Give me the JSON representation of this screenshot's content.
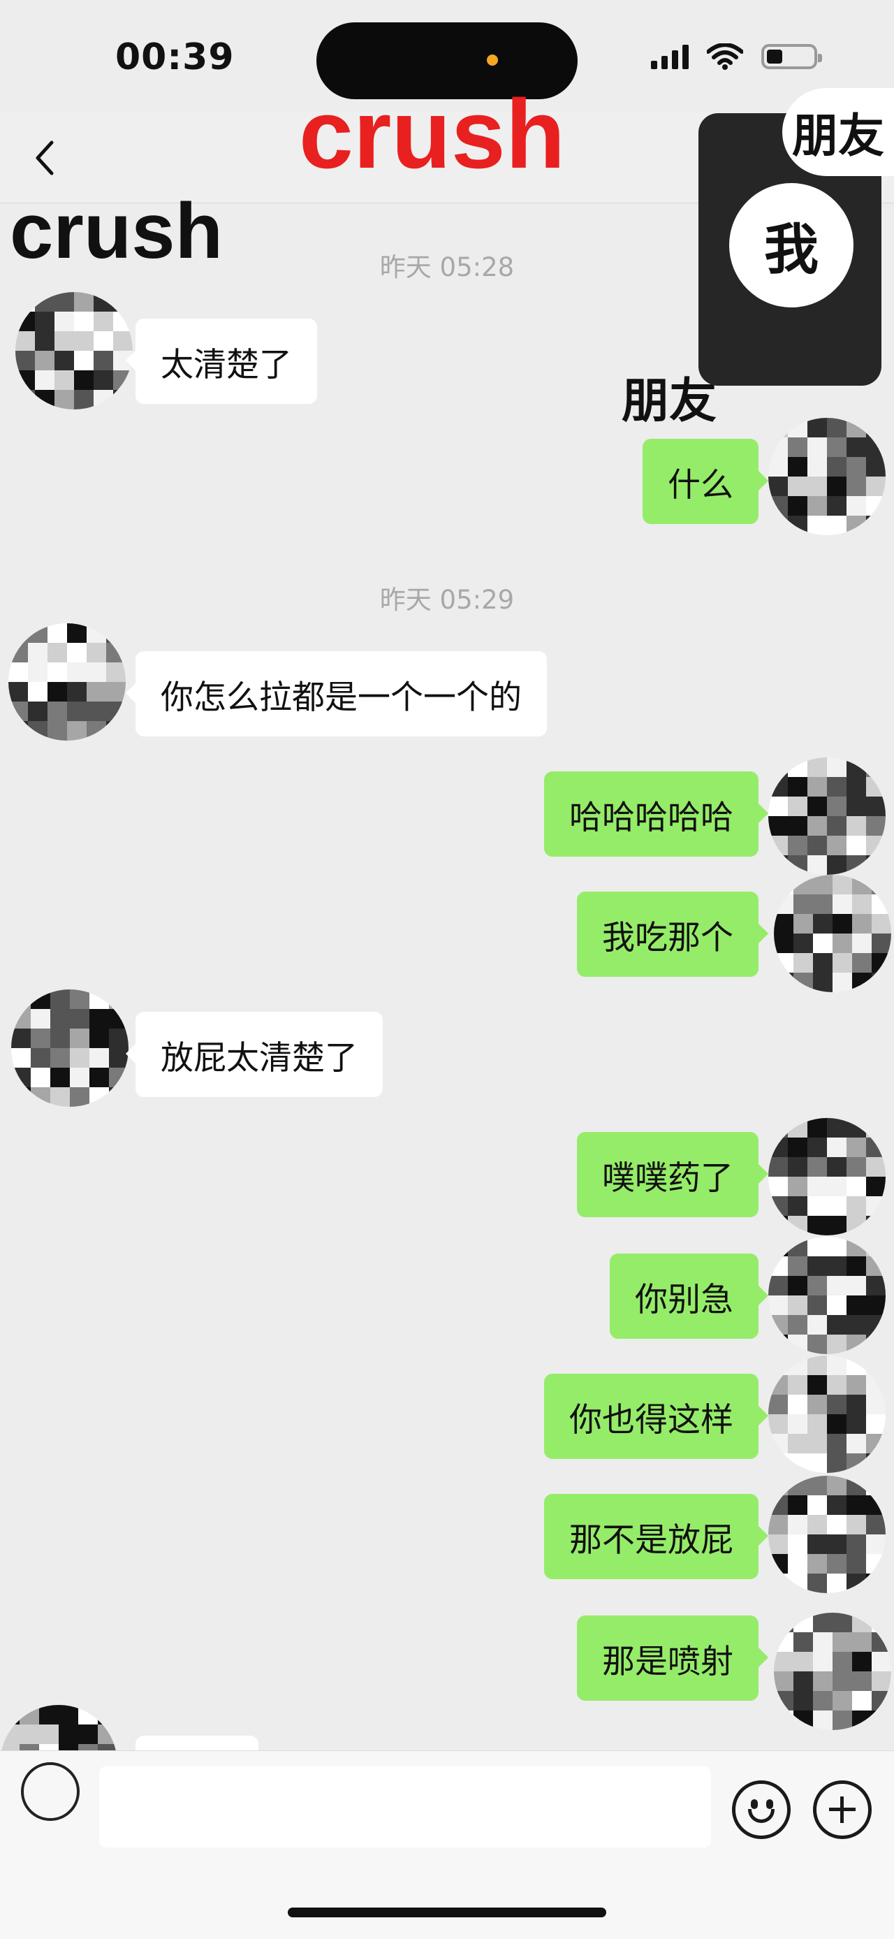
{
  "status_bar": {
    "time": "00:39",
    "icons": [
      "cellular-signal-icon",
      "wifi-icon",
      "battery-icon"
    ],
    "battery_level": 0.35
  },
  "navbar": {
    "back_icon": "chevron-left-icon"
  },
  "overlays": {
    "title": "crush",
    "crush_label": "crush",
    "friend_label": "朋友",
    "pip_me": "我",
    "pip_friend": "朋友"
  },
  "timestamps": [
    "昨天 05:28",
    "昨天 05:29"
  ],
  "messages": [
    {
      "side": "in",
      "text": "太清楚了"
    },
    {
      "side": "out",
      "text": "什么"
    },
    {
      "side": "in",
      "text": "你怎么拉都是一个一个的"
    },
    {
      "side": "out",
      "text": "哈哈哈哈哈"
    },
    {
      "side": "out",
      "text": "我吃那个"
    },
    {
      "side": "in",
      "text": "放屁太清楚了"
    },
    {
      "side": "out",
      "text": "噗噗药了"
    },
    {
      "side": "out",
      "text": "你别急"
    },
    {
      "side": "out",
      "text": "你也得这样"
    },
    {
      "side": "out",
      "text": "那不是放屁"
    },
    {
      "side": "out",
      "text": "那是喷射"
    }
  ],
  "input_bar": {
    "value": "",
    "icons": [
      "voice-icon",
      "emoji-icon",
      "plus-icon"
    ]
  },
  "colors": {
    "outgoing_bubble": "#95ec69",
    "incoming_bubble": "#ffffff",
    "title_overlay": "#e8201f",
    "background": "#ededed"
  }
}
